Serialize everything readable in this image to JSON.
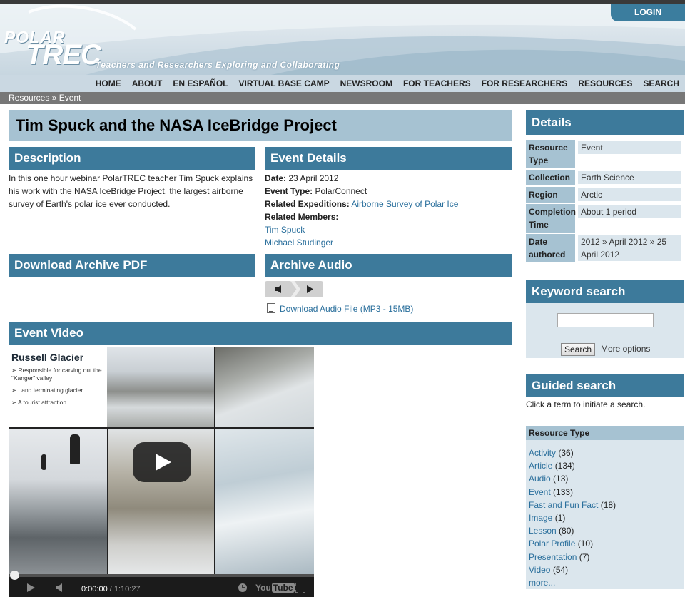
{
  "header": {
    "login_label": "LOGIN",
    "logo_line1": "POLAR",
    "logo_line2": "TREC",
    "tagline": "Teachers and Researchers Exploring and Collaborating"
  },
  "nav": {
    "items": [
      "HOME",
      "ABOUT",
      "EN ESPAÑOL",
      "VIRTUAL BASE CAMP",
      "NEWSROOM",
      "FOR TEACHERS",
      "FOR RESEARCHERS",
      "RESOURCES",
      "SEARCH"
    ]
  },
  "breadcrumb": "Resources » Event",
  "page_title": "Tim Spuck and the NASA IceBridge Project",
  "description": {
    "heading": "Description",
    "body": "In this one hour webinar PolarTREC teacher Tim Spuck explains his work with the NASA IceBridge Project, the largest airborne survey of Earth's polar ice ever conducted."
  },
  "event_details": {
    "heading": "Event Details",
    "date_label": "Date:",
    "date_value": " 23 April 2012",
    "type_label": "Event Type:",
    "type_value": " PolarConnect",
    "expeditions_label": "Related Expeditions:",
    "expeditions_value": "Airborne Survey of Polar Ice",
    "members_label": "Related Members:",
    "members": [
      "Tim Spuck",
      "Michael Studinger"
    ]
  },
  "download_pdf": {
    "heading": "Download Archive PDF"
  },
  "archive_audio": {
    "heading": "Archive Audio",
    "download_label": "Download Audio File (MP3 - 15MB)"
  },
  "event_video": {
    "heading": "Event Video",
    "slide_title": "Russell Glacier",
    "slide_bullets": [
      "➢  Responsible for carving out the “Kanger” valley",
      "➢  Land terminating glacier",
      "➢  A tourist attraction"
    ],
    "time_current": "0:00:00",
    "time_total": " / 1:10:27",
    "youtube_label": "You"
  },
  "details": {
    "heading": "Details",
    "rows": [
      {
        "label": "Resource Type",
        "value": "Event"
      },
      {
        "label": "Collection",
        "value": "Earth Science"
      },
      {
        "label": "Region",
        "value": "Arctic"
      },
      {
        "label": "Completion Time",
        "value": "About 1 period"
      },
      {
        "label": "Date authored",
        "value": "2012 » April 2012 » 25 April 2012"
      }
    ]
  },
  "keyword_search": {
    "heading": "Keyword search",
    "input_value": "",
    "button_label": "Search",
    "more_label": "More options"
  },
  "guided_search": {
    "heading": "Guided search",
    "note": "Click a term to initiate a search.",
    "resource_type_heading": "Resource Type",
    "items": [
      {
        "label": "Activity",
        "count": "(36)"
      },
      {
        "label": "Article",
        "count": "(134)"
      },
      {
        "label": "Audio",
        "count": "(13)"
      },
      {
        "label": "Event",
        "count": "(133)"
      },
      {
        "label": "Fast and Fun Fact",
        "count": "(18)"
      },
      {
        "label": "Image",
        "count": "(1)"
      },
      {
        "label": "Lesson",
        "count": "(80)"
      },
      {
        "label": "Polar Profile",
        "count": "(10)"
      },
      {
        "label": "Presentation",
        "count": "(7)"
      },
      {
        "label": "Video",
        "count": "(54)"
      },
      {
        "label": "more...",
        "count": ""
      }
    ]
  }
}
